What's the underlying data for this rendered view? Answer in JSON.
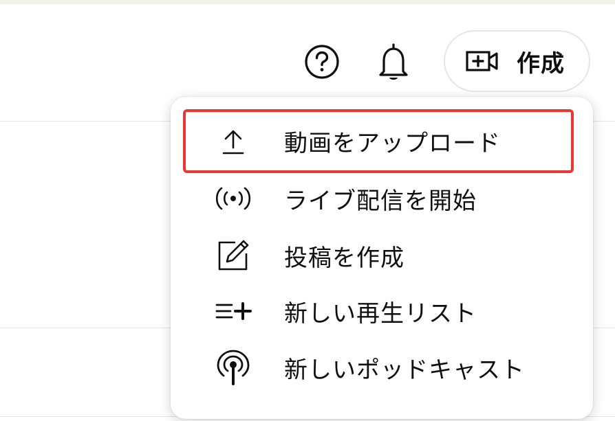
{
  "header": {
    "help_icon": "help-circle-icon",
    "notifications_icon": "bell-icon",
    "create_button": {
      "label": "作成",
      "icon": "video-add-icon"
    }
  },
  "create_menu": {
    "items": [
      {
        "label": "動画をアップロード",
        "icon": "upload-icon"
      },
      {
        "label": "ライブ配信を開始",
        "icon": "live-broadcast-icon"
      },
      {
        "label": "投稿を作成",
        "icon": "edit-post-icon"
      },
      {
        "label": "新しい再生リスト",
        "icon": "playlist-add-icon"
      },
      {
        "label": "新しいポッドキャスト",
        "icon": "podcast-icon"
      }
    ],
    "highlighted_item": "動画をアップロード"
  },
  "colors": {
    "highlight_border": "#e53a33",
    "text": "#0f0f0f"
  }
}
